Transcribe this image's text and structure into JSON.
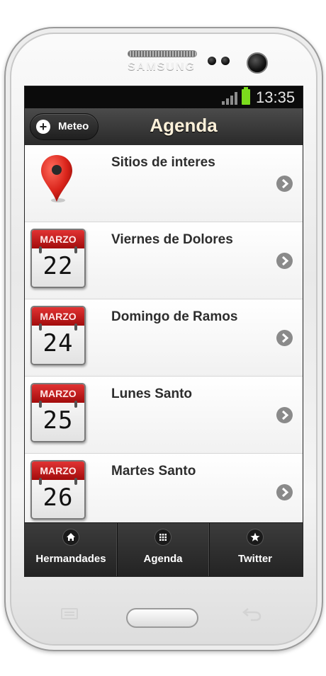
{
  "device": {
    "brand": "SAMSUNG"
  },
  "status_bar": {
    "time": "13:35"
  },
  "header": {
    "left_button_label": "Meteo",
    "title": "Agenda"
  },
  "list": {
    "items": [
      {
        "label": "Sitios de interes",
        "icon": "map-pin-icon"
      },
      {
        "label": "Viernes de Dolores",
        "month": "MARZO",
        "day": "22",
        "icon": "calendar-icon"
      },
      {
        "label": "Domingo de Ramos",
        "month": "MARZO",
        "day": "24",
        "icon": "calendar-icon"
      },
      {
        "label": "Lunes Santo",
        "month": "MARZO",
        "day": "25",
        "icon": "calendar-icon"
      },
      {
        "label": "Martes Santo",
        "month": "MARZO",
        "day": "26",
        "icon": "calendar-icon"
      }
    ]
  },
  "tabbar": {
    "tabs": [
      {
        "label": "Hermandades",
        "icon": "home-icon"
      },
      {
        "label": "Agenda",
        "icon": "grid-icon"
      },
      {
        "label": "Twitter",
        "icon": "star-icon"
      }
    ]
  },
  "colors": {
    "header_title": "#fdf1da",
    "calendar_red": "#c41d1d",
    "battery_green": "#7bdc1d",
    "chevron_gray": "#8a8a8a"
  }
}
